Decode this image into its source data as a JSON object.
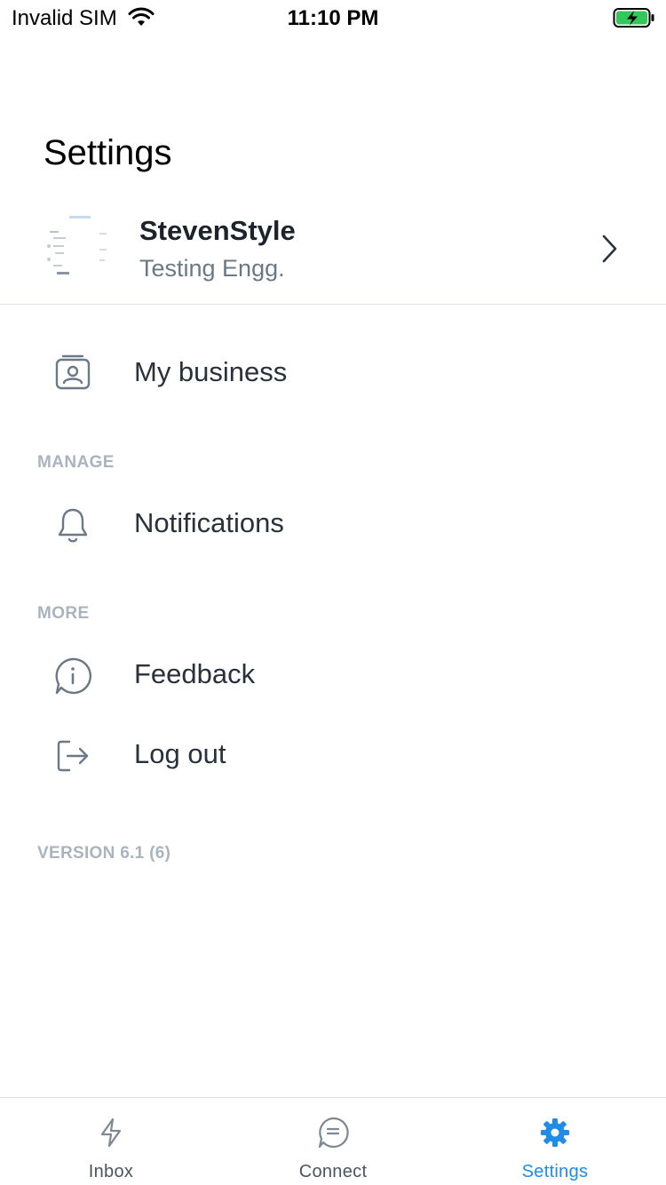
{
  "status_bar": {
    "carrier": "Invalid SIM",
    "time": "11:10 PM",
    "battery_color": "#34c759"
  },
  "header": {
    "title": "Settings"
  },
  "profile": {
    "name": "StevenStyle",
    "role": "Testing Engg."
  },
  "items": {
    "my_business": "My business",
    "notifications": "Notifications",
    "feedback": "Feedback",
    "logout": "Log out"
  },
  "sections": {
    "manage": "MANAGE",
    "more": "MORE"
  },
  "version": "VERSION 6.1 (6)",
  "tabs": [
    {
      "label": "Inbox",
      "icon": "lightning-icon",
      "active": false
    },
    {
      "label": "Connect",
      "icon": "chat-icon",
      "active": false
    },
    {
      "label": "Settings",
      "icon": "gear-icon",
      "active": true
    }
  ],
  "colors": {
    "accent": "#1f8ce6",
    "section_header": "#aab4bf",
    "icon": "#6b7886"
  }
}
